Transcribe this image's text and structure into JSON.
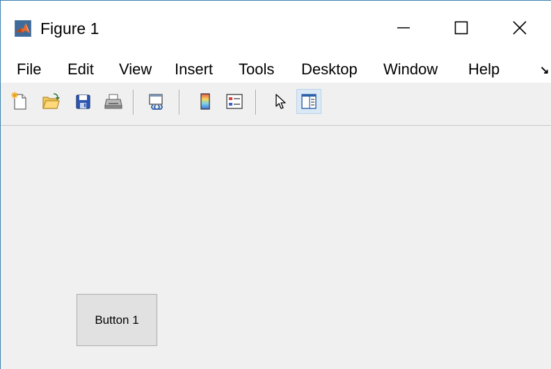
{
  "window": {
    "title": "Figure 1",
    "app_icon": "matlab-logo-icon",
    "controls": {
      "minimize": "minimize-icon",
      "maximize": "maximize-icon",
      "close": "close-icon"
    }
  },
  "menubar": {
    "items": [
      "File",
      "Edit",
      "View",
      "Insert",
      "Tools",
      "Desktop",
      "Window",
      "Help"
    ],
    "overflow": "↘"
  },
  "toolbar": {
    "buttons": [
      {
        "name": "new-figure-icon"
      },
      {
        "name": "open-file-icon"
      },
      {
        "name": "save-icon"
      },
      {
        "name": "print-icon"
      },
      {
        "name": "link-plot-icon"
      },
      {
        "name": "insert-colorbar-icon"
      },
      {
        "name": "insert-legend-icon"
      },
      {
        "name": "edit-plot-pointer-icon"
      },
      {
        "name": "show-plot-tools-icon",
        "active": true
      }
    ]
  },
  "figure": {
    "button_label": "Button 1"
  },
  "colors": {
    "window_border": "#3c7fb1",
    "background": "#f0f0f0",
    "active_tool": "#dbe9f6"
  }
}
